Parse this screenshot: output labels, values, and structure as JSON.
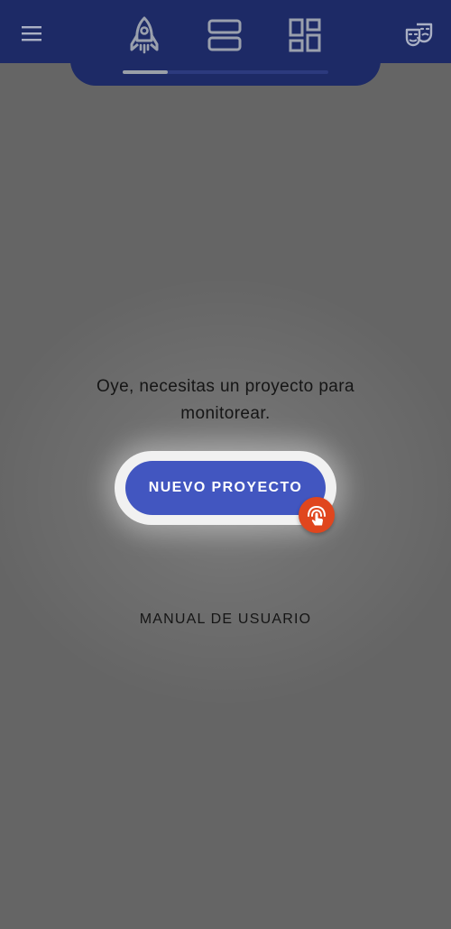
{
  "header": {
    "menu_icon": "hamburger-menu-icon",
    "tabs": [
      {
        "icon": "rocket-icon",
        "selected": true
      },
      {
        "icon": "list-view-icon",
        "selected": false
      },
      {
        "icon": "dashboard-icon",
        "selected": false
      }
    ],
    "right_icon": "theater-masks-icon"
  },
  "main": {
    "message": "Oye, necesitas un proyecto para monitorear.",
    "primary_button_label": "NUEVO PROYECTO",
    "tap_hint_icon": "tap-hand-icon",
    "manual_link_label": "MANUAL DE USUARIO"
  },
  "colors": {
    "header_bg": "#1d2a66",
    "primary": "#4256c0",
    "tap_badge": "#e0461e",
    "overlay": "#656565"
  }
}
